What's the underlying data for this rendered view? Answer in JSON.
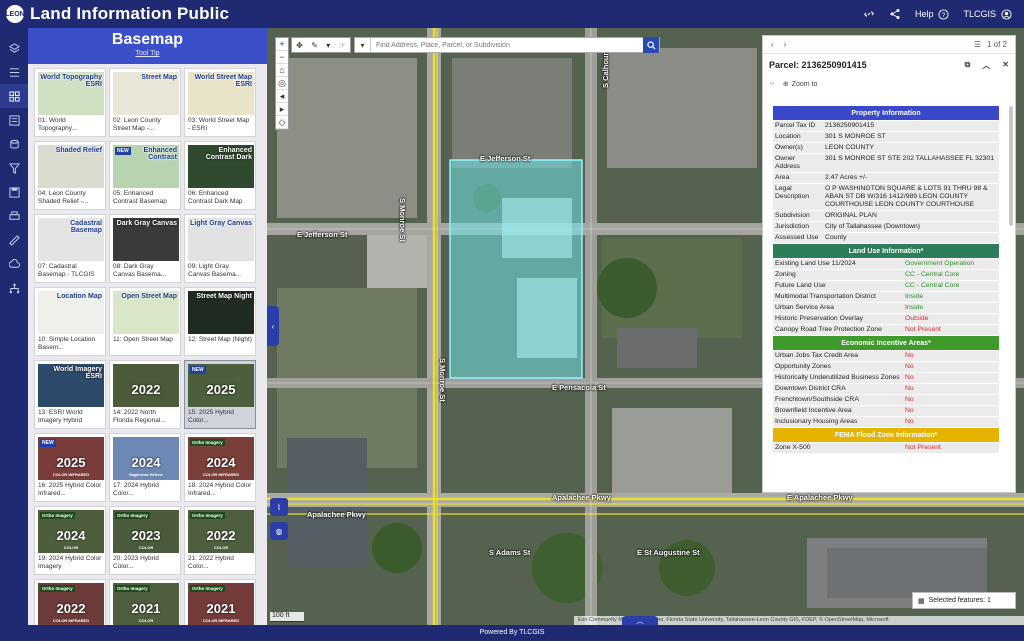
{
  "header": {
    "logo_text": "LEON",
    "title": "Land Information Public",
    "help_label": "Help",
    "user_label": "TLCGIS",
    "icons": [
      "link-icon",
      "share-icon",
      "help-icon",
      "user-icon"
    ]
  },
  "rail": {
    "icons": [
      "layers-icon",
      "list-icon",
      "basemap-grid-icon",
      "legend-icon",
      "database-icon",
      "filter-icon",
      "save-icon",
      "print-icon",
      "measure-icon",
      "weather-icon",
      "hierarchy-icon"
    ]
  },
  "basemap": {
    "title": "Basemap",
    "tooltip": "Tool Tip",
    "tiles": [
      {
        "label": "World Topography ESRI",
        "caption": "01: World Topography...",
        "bg": "#cfe0c3",
        "badge": "",
        "year": "",
        "selected": false
      },
      {
        "label": "Street Map",
        "caption": "02: Leon County Street Map -...",
        "bg": "#e8e6d6",
        "badge": "",
        "year": "",
        "selected": false
      },
      {
        "label": "World Street Map ESRI",
        "caption": "03: World Street Map - ESRI",
        "bg": "#e9e3c8",
        "badge": "",
        "year": "",
        "selected": false
      },
      {
        "label": "Shaded Relief",
        "caption": "04: Leon County Shaded Relief -...",
        "bg": "#d9dccf",
        "badge": "",
        "year": "",
        "selected": false
      },
      {
        "label": "Enhanced Contrast",
        "caption": "05: Enhanced Contrast Basemap",
        "bg": "#b7d3b0",
        "badge": "NEW",
        "year": "",
        "selected": false
      },
      {
        "label": "Enhanced Contrast Dark",
        "caption": "06: Enhanced Contrast Dark Map",
        "bg": "#2f4a2f",
        "badge": "",
        "year": "",
        "selected": false
      },
      {
        "label": "Cadastral Basemap",
        "caption": "07: Cadastral Basemap - TLCGIS",
        "bg": "#e4e4e4",
        "badge": "",
        "year": "",
        "selected": false
      },
      {
        "label": "Dark Gray Canvas",
        "caption": "08: Dark Gray Canvas Basema...",
        "bg": "#3a3a3a",
        "badge": "",
        "year": "",
        "selected": false
      },
      {
        "label": "Light Gray Canvas",
        "caption": "09: Light Gray Canvas Basema...",
        "bg": "#e2e2e2",
        "badge": "",
        "year": "",
        "selected": false
      },
      {
        "label": "Location Map",
        "caption": "10: Simple Location Basem...",
        "bg": "#eef0ec",
        "badge": "",
        "year": "",
        "selected": false
      },
      {
        "label": "Open Street Map",
        "caption": "11: Open Street Map",
        "bg": "#d9e6c8",
        "badge": "",
        "year": "",
        "selected": false
      },
      {
        "label": "Street Map Night",
        "caption": "12: Street Map (Night)",
        "bg": "#1f2b20",
        "badge": "",
        "year": "",
        "selected": false
      },
      {
        "label": "World Imagery ESRI",
        "caption": "13: ESRI World Imagery Hybrid",
        "bg": "#2c4a6a",
        "badge": "",
        "year": "",
        "selected": false
      },
      {
        "label": "",
        "caption": "14: 2022 North Florida Regional...",
        "bg": "#4d5a3a",
        "badge": "",
        "year": "2022",
        "selected": false
      },
      {
        "label": "",
        "caption": "15: 2025 Hybrid Color...",
        "bg": "#4c5e3c",
        "badge": "NEW",
        "year": "2025",
        "selected": true
      },
      {
        "label": "COLOR INFRARED",
        "caption": "16: 2025 Hybrid Color Infrared...",
        "bg": "#7a3b3b",
        "badge": "NEW",
        "year": "2025",
        "selected": false
      },
      {
        "label": "Eagleview Helene",
        "caption": "17: 2024 Hybrid Color...",
        "bg": "#6e88b6",
        "badge": "",
        "year": "2024",
        "selected": false
      },
      {
        "label": "COLOR INFRARED",
        "caption": "18: 2024 Hybrid Color Infrared...",
        "bg": "#7a3f3a",
        "badge": "Ortho Imagery",
        "year": "2024",
        "selected": false
      },
      {
        "label": "COLOR",
        "caption": "19: 2024 Hybrid Color Imagery",
        "bg": "#4e5e3c",
        "badge": "Ortho Imagery",
        "year": "2024",
        "selected": false
      },
      {
        "label": "COLOR",
        "caption": "20: 2023 Hybrid Color...",
        "bg": "#4b5a3c",
        "badge": "Ortho Imagery",
        "year": "2023",
        "selected": false
      },
      {
        "label": "COLOR",
        "caption": "21: 2022 Hybrid Color...",
        "bg": "#505e40",
        "badge": "Ortho Imagery",
        "year": "2022",
        "selected": false
      },
      {
        "label": "COLOR INFRARED",
        "caption": "",
        "bg": "#6d3b3a",
        "badge": "Ortho Imagery",
        "year": "2022",
        "selected": false
      },
      {
        "label": "COLOR",
        "caption": "",
        "bg": "#4f5e3e",
        "badge": "Ortho Imagery",
        "year": "2021",
        "selected": false
      },
      {
        "label": "COLOR INFRARED",
        "caption": "",
        "bg": "#733c3a",
        "badge": "Ortho Imagery",
        "year": "2021",
        "selected": false
      }
    ]
  },
  "map": {
    "search_placeholder": "Find Address, Place, Parcel, or Subdivision",
    "streets": [
      "E Jefferson St",
      "E Jefferson St",
      "E Pensacola St",
      "S Monroe St",
      "S Monroe St",
      "S Calhoun St",
      "Apalachee Pkwy",
      "Apalachee Pkwy",
      "E Apalachee Pkwy",
      "S Adams St",
      "E St Augustine St"
    ],
    "scale": "100 ft",
    "attribution": "Esri Community Maps Contributors, Florida State University, Tallahassee-Leon County GIS, FDEP, © OpenStreetMap, Microsoft",
    "selected_features": "Selected features: 1"
  },
  "popup": {
    "pager": "1 of 2",
    "title": "Parcel: 2136250901415",
    "zoom_label": "Zoom to",
    "sections": {
      "property": "Property Information",
      "land_use": "Land Use Information*",
      "economic": "Economic Incentive Areas*",
      "fema": "FEMA Flood Zone Information*"
    },
    "property_rows": [
      {
        "k": "Parcel Tax ID",
        "v": "2136250901415"
      },
      {
        "k": "Location",
        "v": "301 S MONROE ST"
      },
      {
        "k": "Owner(s)",
        "v": "LEON COUNTY"
      },
      {
        "k": "Owner Address",
        "v": "301 S MONROE ST STE 202 TALLAHASSEE FL 32301"
      },
      {
        "k": "Area",
        "v": "2.47 Acres +/-"
      },
      {
        "k": "Legal Description",
        "v": "O P WASHINGTON SQUARE & LOTS 91 THRU 98 & ABAN ST DB W/316 1412/989 LEON COUNTY COURTHOUSE LEON COUNTY COURTHOUSE"
      },
      {
        "k": "Subdivision",
        "v": "ORIGINAL PLAN"
      },
      {
        "k": "Jurisdiction",
        "v": "City of Tallahassee (Downtown)"
      },
      {
        "k": "Assessed Use",
        "v": "County"
      }
    ],
    "land_use_rows": [
      {
        "k": "Existing Land Use 11/2024",
        "v": "Government Operation",
        "c": "green"
      },
      {
        "k": "Zoning",
        "v": "CC - Central Core",
        "c": "green"
      },
      {
        "k": "Future Land Use",
        "v": "CC - Central Core",
        "c": "green"
      },
      {
        "k": "Multimodal Transportation District",
        "v": "Inside",
        "c": "green"
      },
      {
        "k": "Urban Service Area",
        "v": "Inside",
        "c": "green"
      },
      {
        "k": "Historic Preservation Overlay",
        "v": "Outside",
        "c": "red"
      },
      {
        "k": "Canopy Road Tree Protection Zone",
        "v": "Not Present",
        "c": "red"
      }
    ],
    "economic_rows": [
      {
        "k": "Urban Jobs Tax Credit Area",
        "v": "No",
        "c": "red"
      },
      {
        "k": "Opportunity Zones",
        "v": "No",
        "c": "red"
      },
      {
        "k": "Historically Underutilized Business Zones",
        "v": "No",
        "c": "red"
      },
      {
        "k": "Downtown District CRA",
        "v": "No",
        "c": "red"
      },
      {
        "k": "Frenchtown/Southside CRA",
        "v": "No",
        "c": "red"
      },
      {
        "k": "Brownfield Incentive Area",
        "v": "No",
        "c": "red"
      },
      {
        "k": "Inclusionary Housing Areas",
        "v": "No",
        "c": "red"
      }
    ],
    "fema_rows": [
      {
        "k": "Zone X-500",
        "v": "Not Present",
        "c": "red"
      }
    ]
  },
  "footer": "Powered By TLCGIS",
  "colors": {
    "header": "#1f2a72",
    "panel_head": "#3b4fc8",
    "sec_property": "#3a49c9",
    "sec_land_use": "#2e7d5a",
    "sec_economic": "#3f9a2b",
    "sec_fema": "#e6b400"
  }
}
